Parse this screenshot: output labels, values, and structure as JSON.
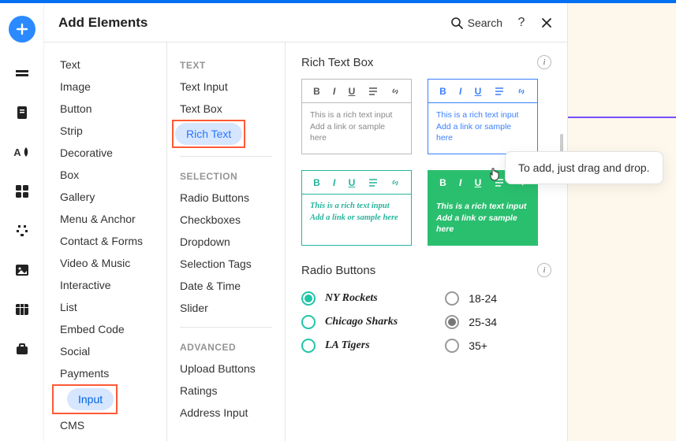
{
  "header": {
    "title": "Add Elements",
    "search_label": "Search"
  },
  "leftbar_icons": [
    "plus",
    "layers",
    "page",
    "font",
    "grid",
    "plugin",
    "image",
    "table",
    "briefcase"
  ],
  "categories": [
    {
      "label": "Text"
    },
    {
      "label": "Image"
    },
    {
      "label": "Button"
    },
    {
      "label": "Strip"
    },
    {
      "label": "Decorative"
    },
    {
      "label": "Box"
    },
    {
      "label": "Gallery"
    },
    {
      "label": "Menu & Anchor"
    },
    {
      "label": "Contact & Forms"
    },
    {
      "label": "Video & Music"
    },
    {
      "label": "Interactive"
    },
    {
      "label": "List"
    },
    {
      "label": "Embed Code"
    },
    {
      "label": "Social"
    },
    {
      "label": "Payments"
    },
    {
      "label": "Input",
      "selected": true,
      "highlight": true
    },
    {
      "label": "CMS"
    }
  ],
  "sub_groups": [
    {
      "label": "TEXT",
      "items": [
        {
          "label": "Text Input"
        },
        {
          "label": "Text Box"
        },
        {
          "label": "Rich Text",
          "selected": true,
          "highlight": true
        }
      ]
    },
    {
      "label": "SELECTION",
      "items": [
        {
          "label": "Radio Buttons"
        },
        {
          "label": "Checkboxes"
        },
        {
          "label": "Dropdown"
        },
        {
          "label": "Selection Tags"
        },
        {
          "label": "Date & Time"
        },
        {
          "label": "Slider"
        }
      ]
    },
    {
      "label": "ADVANCED",
      "items": [
        {
          "label": "Upload Buttons"
        },
        {
          "label": "Ratings"
        },
        {
          "label": "Address Input"
        }
      ]
    }
  ],
  "sections": {
    "rich_text": {
      "title": "Rich Text Box",
      "sample_line1": "This is a rich text input",
      "sample_line2": "Add a link or sample here",
      "sample_combined": "This is a rich text input Add a link or sample here"
    },
    "radio": {
      "title": "Radio Buttons",
      "groupA": {
        "options": [
          "NY Rockets",
          "Chicago Sharks",
          "LA Tigers"
        ],
        "selected": 0
      },
      "groupB": {
        "options": [
          "18-24",
          "25-34",
          "35+"
        ],
        "selected": 1
      }
    }
  },
  "tooltip": "To add, just drag and drop."
}
